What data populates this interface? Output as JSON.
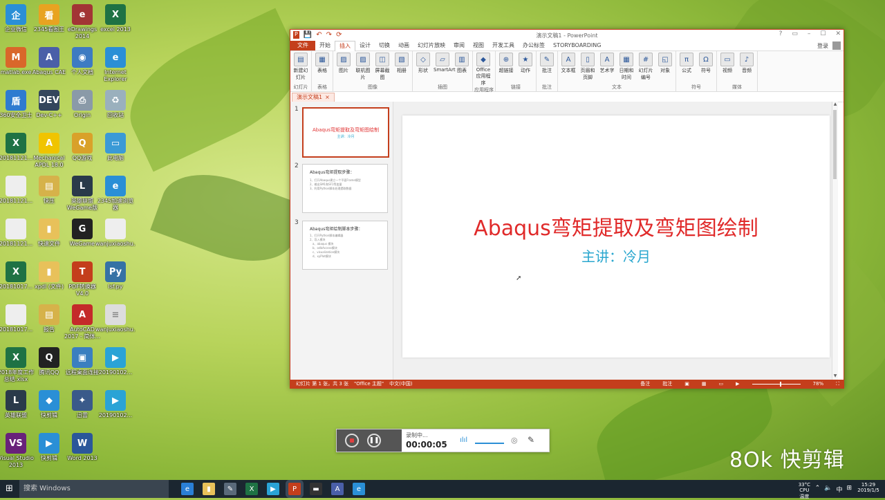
{
  "desktop": {
    "icons": [
      {
        "label": "企业微信",
        "icon": "wecom-icon",
        "color": "#2a8fd6",
        "glyph": "企"
      },
      {
        "label": "2345看图王",
        "icon": "image-viewer-icon",
        "color": "#e8a321",
        "glyph": "看"
      },
      {
        "label": "eDrawings 2014",
        "icon": "edrawings-icon",
        "color": "#a23535",
        "glyph": "e"
      },
      {
        "label": "excel 2013",
        "icon": "excel-icon",
        "color": "#1f7244",
        "glyph": "X"
      },
      {
        "label": "matlab.exe",
        "icon": "matlab-icon",
        "color": "#d9672a",
        "glyph": "M"
      },
      {
        "label": "Abaqus CAE",
        "icon": "abaqus-icon",
        "color": "#4a5fa8",
        "glyph": "A"
      },
      {
        "label": "个人文档",
        "icon": "documents-icon",
        "color": "#3d7bc2",
        "glyph": "◉"
      },
      {
        "label": "Internet Explorer",
        "icon": "ie-icon",
        "color": "#2a8fd6",
        "glyph": "e"
      },
      {
        "label": "360安全卫士",
        "icon": "security-icon",
        "color": "#2f7bd0",
        "glyph": "盾"
      },
      {
        "label": "Dev-C++",
        "icon": "devcpp-icon",
        "color": "#34465c",
        "glyph": "DEV"
      },
      {
        "label": "Origin",
        "icon": "printer-icon",
        "color": "#8a9aa8",
        "glyph": "⎙"
      },
      {
        "label": "回收站",
        "icon": "recycle-bin-icon",
        "color": "#9ab0bd",
        "glyph": "♻"
      },
      {
        "label": "20181121...",
        "icon": "excel-file-icon",
        "color": "#1f7244",
        "glyph": "X"
      },
      {
        "label": "Mechanical APDL 18.0",
        "icon": "ansys-icon",
        "color": "#f0c400",
        "glyph": "A"
      },
      {
        "label": "QQ游戏",
        "icon": "qq-game-icon",
        "color": "#d9a12a",
        "glyph": "Q"
      },
      {
        "label": "此电脑",
        "icon": "computer-icon",
        "color": "#3a9ad6",
        "glyph": "▭"
      },
      {
        "label": "20181121...",
        "icon": "document-icon",
        "color": "#eeeeee",
        "glyph": ""
      },
      {
        "label": "快压",
        "icon": "archive-icon",
        "color": "#d6b24a",
        "glyph": "▤"
      },
      {
        "label": "英雄联盟 WeGame版",
        "icon": "lol-icon",
        "color": "#2a3a4a",
        "glyph": "L"
      },
      {
        "label": "2345加速浏览器",
        "icon": "browser-icon",
        "color": "#2a8fd6",
        "glyph": "e"
      },
      {
        "label": "20181121...",
        "icon": "document-icon",
        "color": "#eeeeee",
        "glyph": ""
      },
      {
        "label": "快速文件",
        "icon": "folder-icon",
        "color": "#e8c15a",
        "glyph": "▮"
      },
      {
        "label": "WeGame",
        "icon": "wegame-icon",
        "color": "#222222",
        "glyph": "G"
      },
      {
        "label": "wanjuxiaoshu...",
        "icon": "document-icon",
        "color": "#eeeeee",
        "glyph": ""
      },
      {
        "label": "20181017...",
        "icon": "excel-file-icon",
        "color": "#1f7244",
        "glyph": "X"
      },
      {
        "label": "xpdl (文件)",
        "icon": "folder-icon",
        "color": "#e8c15a",
        "glyph": "▮"
      },
      {
        "label": "PDF转换器 V4.0",
        "icon": "pdf-converter-icon",
        "color": "#c43e1c",
        "glyph": "T"
      },
      {
        "label": "lsf.py",
        "icon": "python-file-icon",
        "color": "#3572a5",
        "glyph": "Py"
      },
      {
        "label": "20181017...",
        "icon": "document-icon",
        "color": "#eeeeee",
        "glyph": ""
      },
      {
        "label": "报告",
        "icon": "archive-icon",
        "color": "#d6b24a",
        "glyph": "▤"
      },
      {
        "label": "AutoCAD 2017 - 简体...",
        "icon": "autocad-icon",
        "color": "#c42a2a",
        "glyph": "A"
      },
      {
        "label": "wanjuxiaoshu...",
        "icon": "text-file-icon",
        "color": "#dddddd",
        "glyph": "≡"
      },
      {
        "label": "2018年度工作总结.xlsx",
        "icon": "excel-file-icon",
        "color": "#1f7244",
        "glyph": "X"
      },
      {
        "label": "腾讯QQ",
        "icon": "qq-icon",
        "color": "#222222",
        "glyph": "Q"
      },
      {
        "label": "远程桌面连接",
        "icon": "remote-desktop-icon",
        "color": "#3a7fc0",
        "glyph": "▣"
      },
      {
        "label": "20190102...",
        "icon": "video-file-icon",
        "color": "#2aa3d6",
        "glyph": "▶"
      },
      {
        "label": "英雄联盟",
        "icon": "lol-icon",
        "color": "#2a3a4a",
        "glyph": "L"
      },
      {
        "label": "快剪辑",
        "icon": "video-editor-icon",
        "color": "#2a8fd6",
        "glyph": "◆"
      },
      {
        "label": "迅雷",
        "icon": "bird-icon",
        "color": "#3a5a8a",
        "glyph": "✦"
      },
      {
        "label": "20190102...",
        "icon": "video-file-icon",
        "color": "#2aa3d6",
        "glyph": "▶"
      },
      {
        "label": "Visual Studio 2013",
        "icon": "visual-studio-icon",
        "color": "#68217a",
        "glyph": "VS"
      },
      {
        "label": "快剪辑",
        "icon": "video-player-icon",
        "color": "#2a8fd6",
        "glyph": "▶"
      },
      {
        "label": "Word 2013",
        "icon": "word-icon",
        "color": "#2b579a",
        "glyph": "W"
      }
    ]
  },
  "ppt": {
    "window_title": "演示文稿1 - PowerPoint",
    "qat": [
      "💾",
      "↶",
      "↷",
      "⟳"
    ],
    "window_controls": [
      "?",
      "▭",
      "–",
      "☐",
      "✕"
    ],
    "tabs": [
      "文件",
      "开始",
      "插入",
      "设计",
      "切换",
      "动画",
      "幻灯片放映",
      "审阅",
      "视图",
      "开发工具",
      "办公标签",
      "STORYBOARDING"
    ],
    "active_tab": "插入",
    "user": "登录",
    "ribbon_groups": [
      {
        "name": "幻灯片",
        "buttons": [
          {
            "label": "新建幻灯片",
            "icon": "new-slide-icon",
            "glyph": "▤"
          }
        ]
      },
      {
        "name": "表格",
        "buttons": [
          {
            "label": "表格",
            "icon": "table-icon",
            "glyph": "▦"
          }
        ]
      },
      {
        "name": "图像",
        "buttons": [
          {
            "label": "图片",
            "icon": "picture-icon",
            "glyph": "▨"
          },
          {
            "label": "联机图片",
            "icon": "online-picture-icon",
            "glyph": "▨"
          },
          {
            "label": "屏幕截图",
            "icon": "screenshot-icon",
            "glyph": "◫"
          },
          {
            "label": "相册",
            "icon": "album-icon",
            "glyph": "▧"
          }
        ]
      },
      {
        "name": "插图",
        "buttons": [
          {
            "label": "形状",
            "icon": "shapes-icon",
            "glyph": "◇"
          },
          {
            "label": "SmartArt",
            "icon": "smartart-icon",
            "glyph": "▱"
          },
          {
            "label": "图表",
            "icon": "chart-icon",
            "glyph": "▥"
          }
        ]
      },
      {
        "name": "应用程序",
        "buttons": [
          {
            "label": "Office 应用程序",
            "icon": "office-apps-icon",
            "glyph": "◆"
          }
        ]
      },
      {
        "name": "链接",
        "buttons": [
          {
            "label": "超链接",
            "icon": "hyperlink-icon",
            "glyph": "⊕"
          },
          {
            "label": "动作",
            "icon": "action-icon",
            "glyph": "★"
          }
        ]
      },
      {
        "name": "批注",
        "buttons": [
          {
            "label": "批注",
            "icon": "comment-icon",
            "glyph": "✎"
          }
        ]
      },
      {
        "name": "文本",
        "buttons": [
          {
            "label": "文本框",
            "icon": "textbox-icon",
            "glyph": "A"
          },
          {
            "label": "页眉和页脚",
            "icon": "header-footer-icon",
            "glyph": "▯"
          },
          {
            "label": "艺术字",
            "icon": "wordart-icon",
            "glyph": "A"
          },
          {
            "label": "日期和时间",
            "icon": "datetime-icon",
            "glyph": "▦"
          },
          {
            "label": "幻灯片编号",
            "icon": "slide-number-icon",
            "glyph": "#"
          },
          {
            "label": "对象",
            "icon": "object-icon",
            "glyph": "◱"
          }
        ]
      },
      {
        "name": "符号",
        "buttons": [
          {
            "label": "公式",
            "icon": "equation-icon",
            "glyph": "π"
          },
          {
            "label": "符号",
            "icon": "symbol-icon",
            "glyph": "Ω"
          }
        ]
      },
      {
        "name": "媒体",
        "buttons": [
          {
            "label": "视频",
            "icon": "video-icon",
            "glyph": "▭"
          },
          {
            "label": "音频",
            "icon": "audio-icon",
            "glyph": "♪"
          }
        ]
      }
    ],
    "doc_tab": "演示文稿1",
    "thumbnails": [
      {
        "num": "1",
        "title": "Abaqus弯矩提取及弯矩图绘制",
        "sub": "主讲：冷月"
      },
      {
        "num": "2",
        "title": "Abaqus弯矩提取步骤：",
        "lines": [
          "1、打开Abaqus建立一个平面Frame模型",
          "2、输出SM1和SF1等变量",
          "3、利用Python脚本处理提取数据"
        ]
      },
      {
        "num": "3",
        "title": "Abaqus弯矩绘制脚本步骤：",
        "lines": [
          "1、打开Python脚本编辑器",
          "2、导入模块",
          "a、abaqus 模块",
          "b、odbAccess模块",
          "c、visualization模块",
          "d、xyPlot模块"
        ]
      }
    ],
    "slide": {
      "title": "Abaqus弯矩提取及弯矩图绘制",
      "subtitle": "主讲：冷月"
    },
    "status": {
      "slide_info": "幻灯片 第 1 张，共 3 张",
      "theme": "\"Office 主题\"",
      "language": "中文(中国)",
      "notes": "备注",
      "comments": "批注",
      "zoom": "78%"
    }
  },
  "recorder": {
    "status": "录制中...",
    "time": "00:00:05"
  },
  "watermark": "8Ok 快剪辑",
  "taskbar": {
    "search_placeholder": "搜索 Windows",
    "apps": [
      {
        "icon": "edge-icon",
        "glyph": "e",
        "color": "#2a7fd6"
      },
      {
        "icon": "explorer-icon",
        "glyph": "▮",
        "color": "#e8c15a"
      },
      {
        "icon": "notepad-icon",
        "glyph": "✎",
        "color": "#5a6a7a"
      },
      {
        "icon": "excel-icon",
        "glyph": "X",
        "color": "#1f7244"
      },
      {
        "icon": "video-player-icon",
        "glyph": "▶",
        "color": "#2aa3d6"
      },
      {
        "icon": "powerpoint-icon",
        "glyph": "P",
        "color": "#c43e1c"
      },
      {
        "icon": "terminal-icon",
        "glyph": "▬",
        "color": "#333333"
      },
      {
        "icon": "abaqus-icon",
        "glyph": "A",
        "color": "#4a5fa8"
      },
      {
        "icon": "ie-icon",
        "glyph": "e",
        "color": "#2a8fd6"
      }
    ],
    "weather_temp": "33°C",
    "weather_label": "CPU温度",
    "time": "15:29",
    "date": "2019/1/5",
    "tray_icons": [
      "⌃",
      "🔈",
      "中",
      "⊞"
    ]
  }
}
